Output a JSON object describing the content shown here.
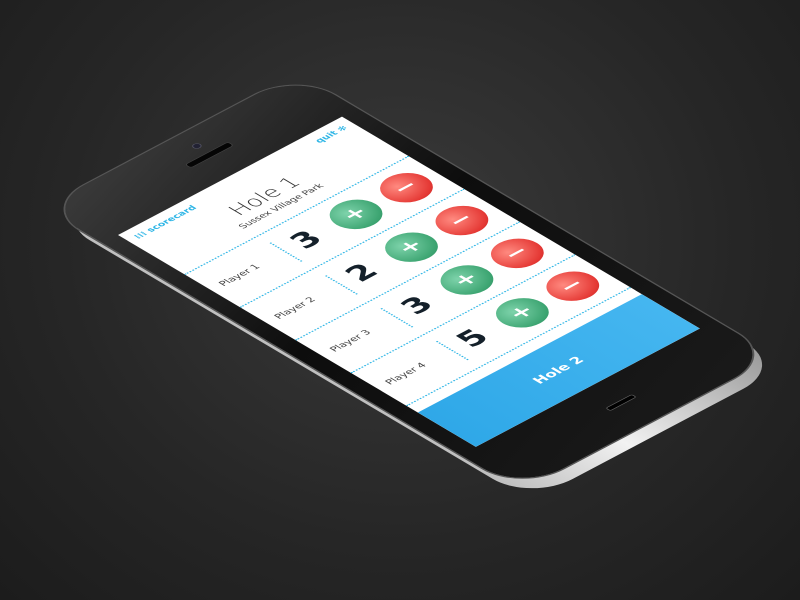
{
  "header": {
    "scorecard_label": "scorecard",
    "scorecard_icon": "grid-icon",
    "quit_label": "quit",
    "quit_icon": "gear-icon"
  },
  "hole": {
    "title": "Hole 1",
    "course": "Sussex Village Park"
  },
  "players": [
    {
      "name": "Player 1",
      "score": "3"
    },
    {
      "name": "Player 2",
      "score": "2"
    },
    {
      "name": "Player 3",
      "score": "3"
    },
    {
      "name": "Player 4",
      "score": "5"
    }
  ],
  "buttons": {
    "plus": "+",
    "minus": "−",
    "next": "Hole 2"
  },
  "colors": {
    "accent": "#2fb6e6",
    "plus": "#3da572",
    "minus": "#e53935"
  }
}
